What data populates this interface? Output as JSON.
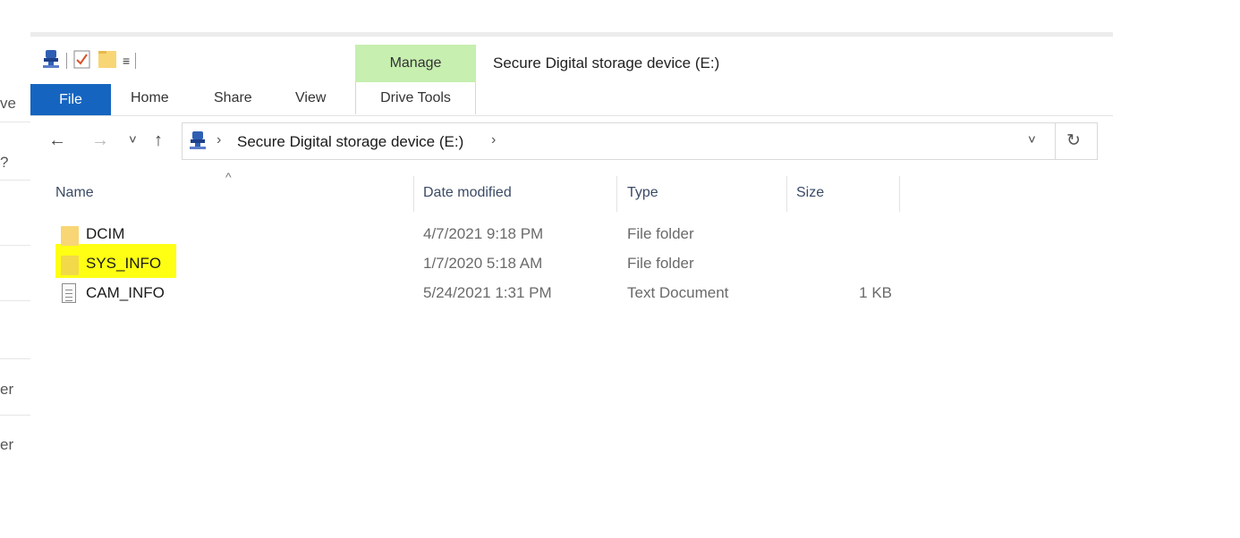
{
  "left_strip": {
    "fragments": [
      "ve",
      "?",
      "er",
      "er"
    ]
  },
  "title_bar": {
    "manage_label": "Manage",
    "title": "Secure Digital storage device (E:)",
    "qat_dropdown_glyph": "≡"
  },
  "ribbon": {
    "file": "File",
    "home": "Home",
    "share": "Share",
    "view": "View",
    "drive_tools": "Drive Tools"
  },
  "nav": {
    "back_glyph": "←",
    "forward_glyph": "→",
    "recent_glyph": "˅",
    "up_glyph": "↑"
  },
  "address": {
    "path": "Secure Digital storage device (E:)",
    "chevron": "›",
    "dropdown_glyph": "˅",
    "refresh_glyph": "↻"
  },
  "columns": {
    "name": "Name",
    "date_modified": "Date modified",
    "type": "Type",
    "size": "Size",
    "sort_caret": "^"
  },
  "files": [
    {
      "name": "DCIM",
      "date": "4/7/2021 9:18 PM",
      "type": "File folder",
      "size": "",
      "icon": "folder-icon"
    },
    {
      "name": "SYS_INFO",
      "date": "1/7/2020 5:18 AM",
      "type": "File folder",
      "size": "",
      "icon": "folder-icon",
      "highlighted": true
    },
    {
      "name": "CAM_INFO",
      "date": "5/24/2021 1:31 PM",
      "type": "Text Document",
      "size": "1 KB",
      "icon": "text-document-icon"
    }
  ],
  "colors": {
    "file_tab": "#1565c0",
    "manage_tab": "#c6efb0",
    "highlight": "#ffff14",
    "folder": "#f8d675"
  }
}
